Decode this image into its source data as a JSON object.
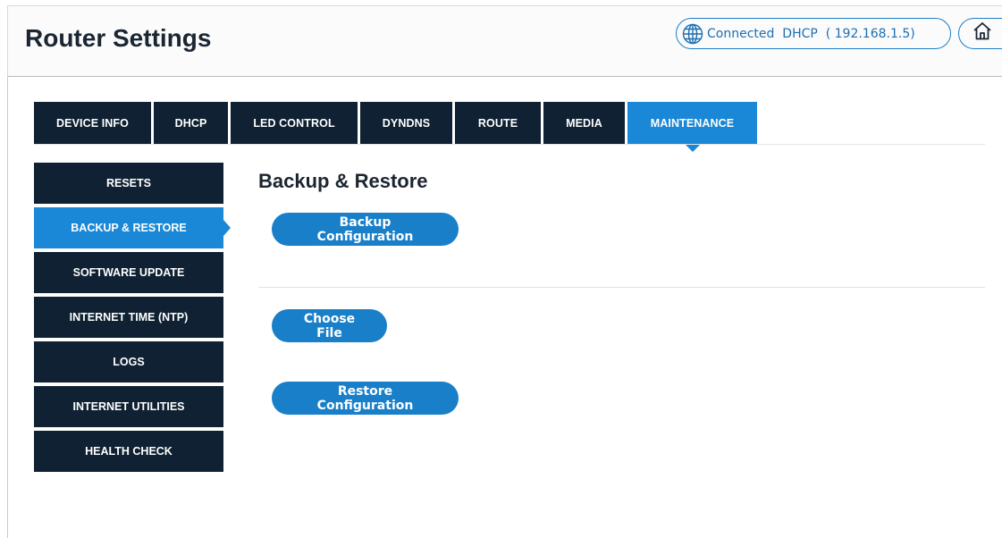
{
  "header": {
    "title": "Router Settings",
    "connection": "Connected  DHCP  ( 192.168.1.5)"
  },
  "icons": {
    "globe": "globe-icon",
    "home": "home-icon"
  },
  "colors": {
    "accent": "#1a88d6",
    "dark": "#0f2132"
  },
  "tabs": [
    {
      "label": "DEVICE INFO",
      "active": false
    },
    {
      "label": "DHCP",
      "active": false
    },
    {
      "label": "LED CONTROL",
      "active": false
    },
    {
      "label": "DYNDNS",
      "active": false
    },
    {
      "label": "ROUTE",
      "active": false
    },
    {
      "label": "MEDIA",
      "active": false
    },
    {
      "label": "MAINTENANCE",
      "active": true
    }
  ],
  "sidebar": {
    "items": [
      {
        "label": "RESETS",
        "active": false
      },
      {
        "label": "BACKUP & RESTORE",
        "active": true
      },
      {
        "label": "SOFTWARE UPDATE",
        "active": false
      },
      {
        "label": "INTERNET TIME (NTP)",
        "active": false
      },
      {
        "label": "LOGS",
        "active": false
      },
      {
        "label": "INTERNET UTILITIES",
        "active": false
      },
      {
        "label": "HEALTH CHECK",
        "active": false
      }
    ]
  },
  "main": {
    "title": "Backup & Restore",
    "backup_label": "Backup Configuration",
    "choose_label": "Choose File",
    "restore_label": "Restore Configuration"
  }
}
